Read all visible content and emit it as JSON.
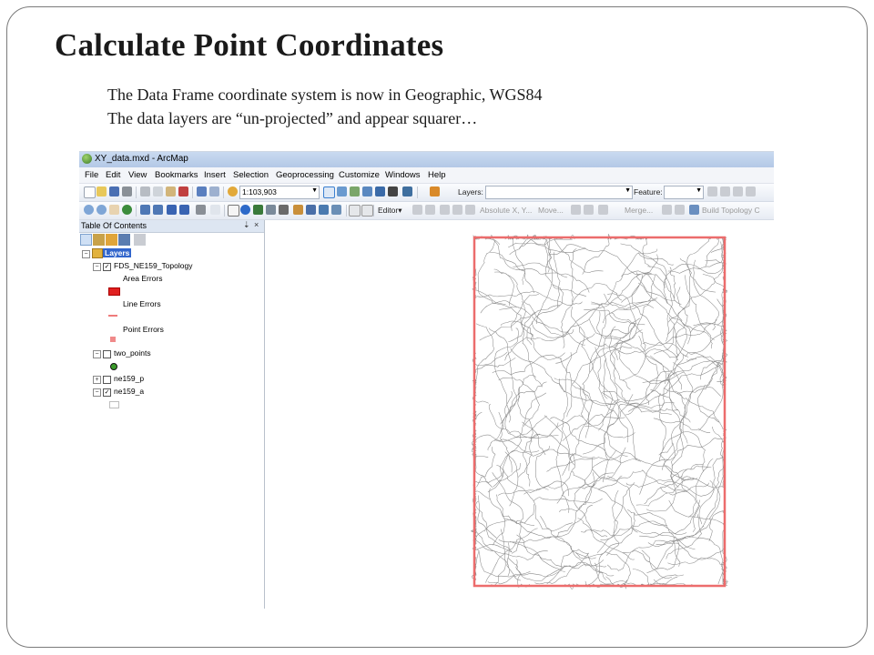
{
  "slide": {
    "title": "Calculate Point Coordinates",
    "lines": [
      "The Data Frame coordinate system is now in Geographic, WGS84",
      "The data layers are “un-projected” and appear squarer…"
    ]
  },
  "app": {
    "window_title": "XY_data.mxd - ArcMap",
    "menu": [
      "File",
      "Edit",
      "View",
      "Bookmarks",
      "Insert",
      "Selection",
      "Geoprocessing",
      "Customize",
      "Windows",
      "Help"
    ],
    "toolbar": {
      "scale_value": "1:103,903",
      "layers_label": "Layers:",
      "feature_label": "Feature:",
      "editor_label": "Editor▾",
      "absolute_xy_label": "Absolute X, Y...",
      "move_label": "Move...",
      "merge_label": "Merge...",
      "build_topology_label": "Build Topology C"
    },
    "toc": {
      "title": "Table Of Contents",
      "pin_glyph": "⇣",
      "close_glyph": "×",
      "root_layer": "Layers",
      "items": [
        {
          "label": "FDS_NE159_Topology",
          "expanded": true,
          "checked": true
        },
        {
          "label": "Area Errors"
        },
        {
          "label": "Line Errors"
        },
        {
          "label": "Point Errors"
        },
        {
          "label": "two_points",
          "expanded": true,
          "checked": false
        },
        {
          "label": "ne159_p",
          "expanded": false,
          "checked": false
        },
        {
          "label": "ne159_a",
          "expanded": true,
          "checked": true
        }
      ]
    },
    "colors": {
      "error_red": "#e02020",
      "line_error": "#ef7b7b",
      "point_error": "#f08a8a",
      "point_symbol": "#3a9a2a",
      "frame_outline": "#ec6c6c",
      "contour": "#8a8a8a",
      "selection": "#3266cc"
    }
  }
}
